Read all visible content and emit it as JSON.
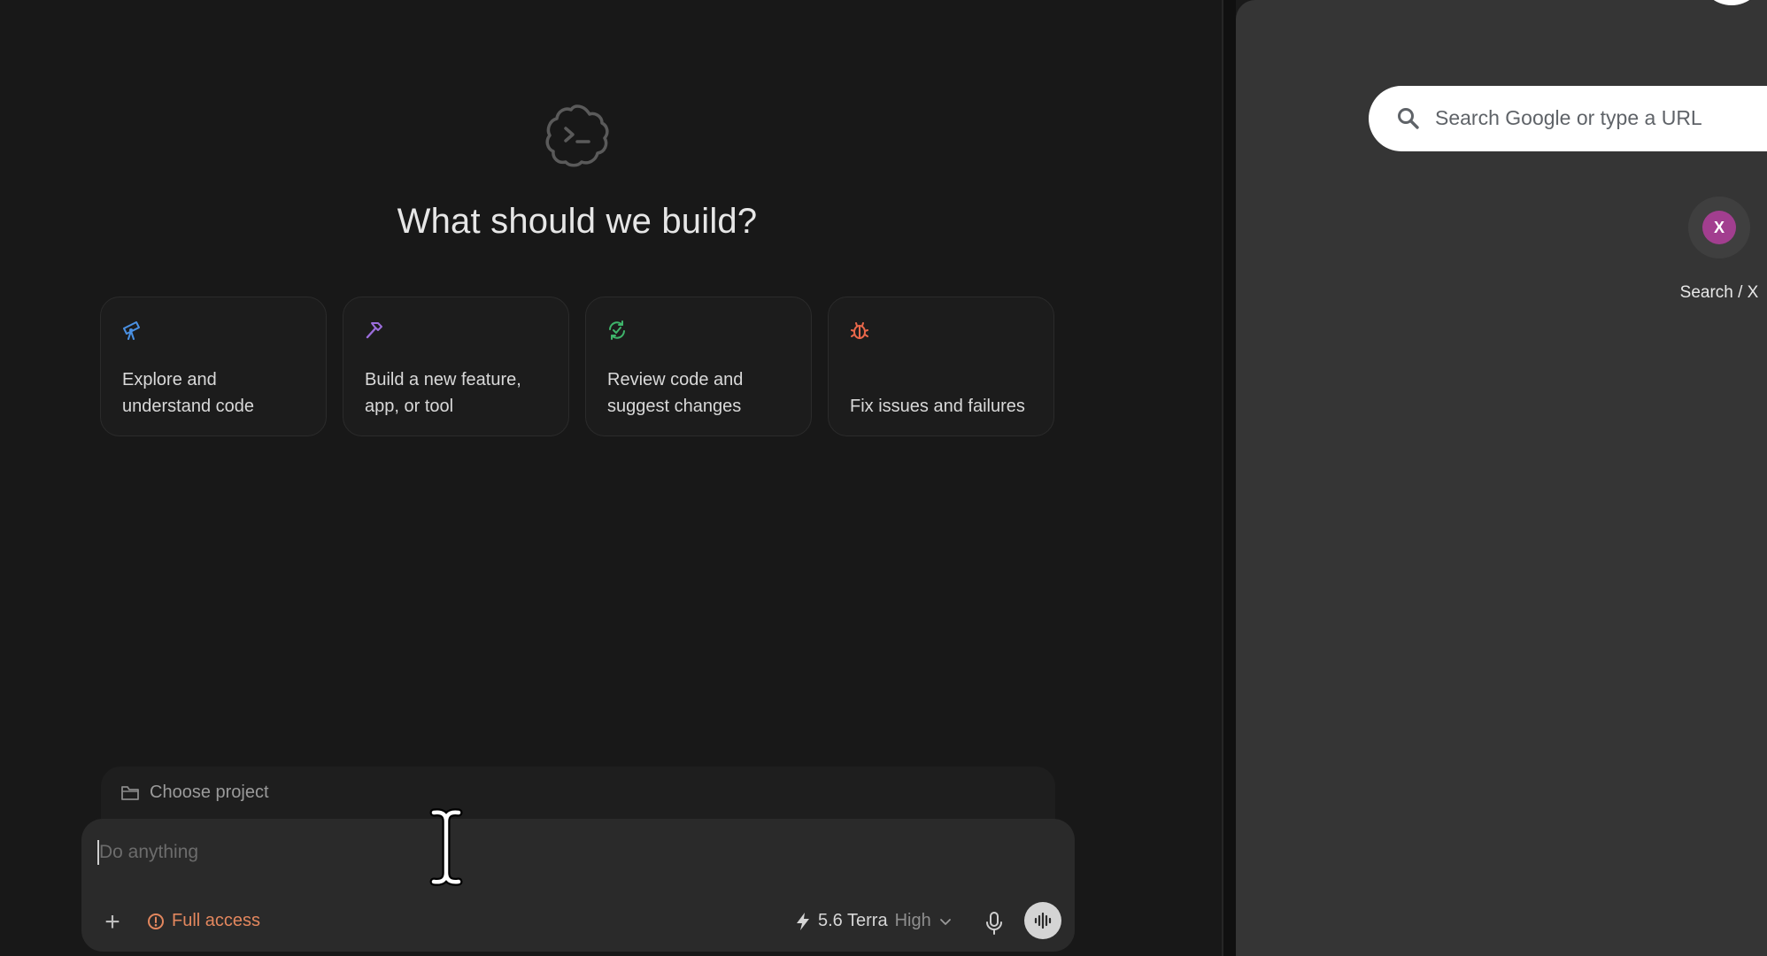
{
  "app": {
    "headline": "What should we build?",
    "logo_icon": "terminal-cloud-icon"
  },
  "suggestions": [
    {
      "label": "Explore and understand code",
      "icon": "telescope-icon",
      "color": "#4a90e2"
    },
    {
      "label": "Build a new feature, app, or tool",
      "icon": "hammer-icon",
      "color": "#9b6ddb"
    },
    {
      "label": "Review code and suggest changes",
      "icon": "review-cycle-icon",
      "color": "#3fb56b"
    },
    {
      "label": "Fix issues and failures",
      "icon": "bug-icon",
      "color": "#e8674a"
    }
  ],
  "project": {
    "label": "Choose project",
    "icon": "folder-icon"
  },
  "composer": {
    "placeholder": "Do anything",
    "add_icon": "plus-icon",
    "access_label": "Full access",
    "access_icon": "alert-circle-icon",
    "model_name": "5.6 Terra",
    "model_level": "High",
    "model_icon": "bolt-icon",
    "mic_icon": "microphone-icon",
    "voice_icon": "voice-waveform-icon"
  },
  "browser": {
    "search_placeholder": "Search Google or type a URL",
    "search_icon": "search-icon",
    "shortcut": {
      "label": "Search / X",
      "favicon_text": "X",
      "favicon_color": "#a23e8f"
    }
  },
  "colors": {
    "accent_warning": "#e3875e",
    "app_background": "#181818",
    "browser_background": "#353535"
  }
}
